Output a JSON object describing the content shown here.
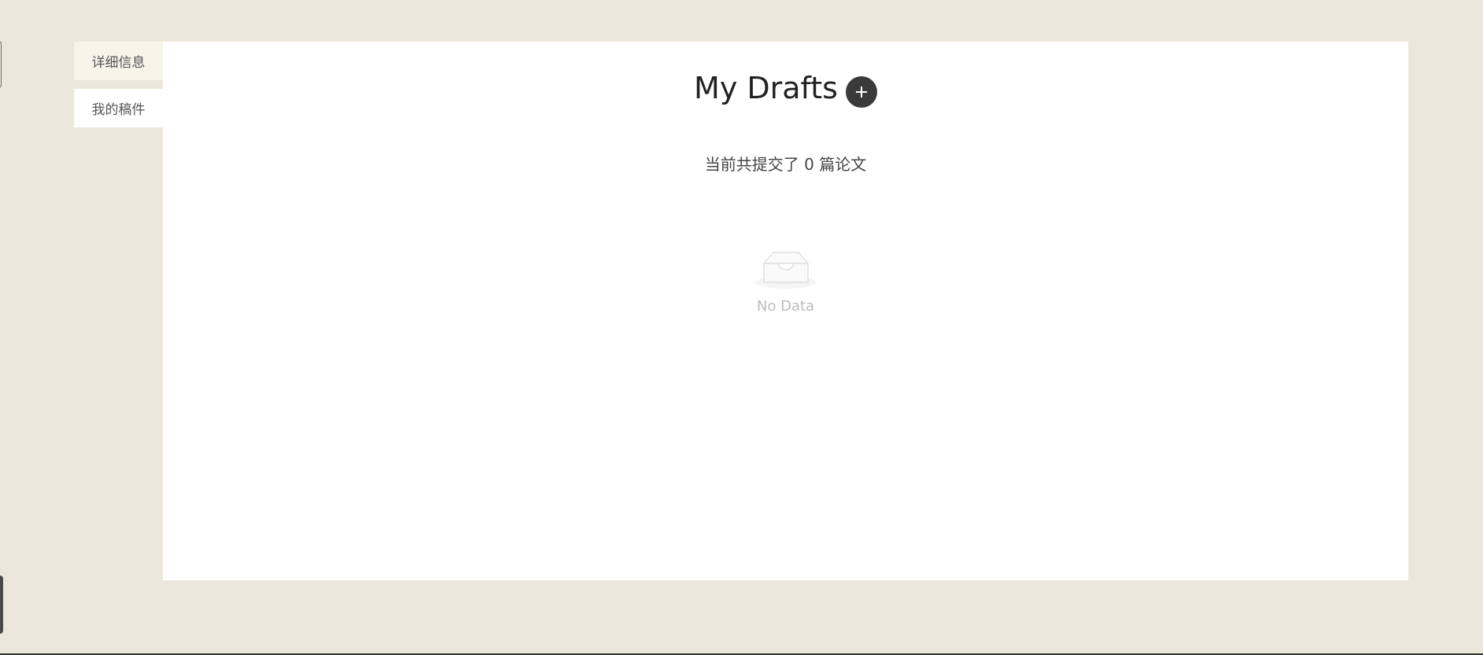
{
  "tabs": [
    {
      "label": "详细信息"
    },
    {
      "label": "我的稿件"
    }
  ],
  "main": {
    "title": "My Drafts",
    "summary": "当前共提交了 0 篇论文",
    "empty_text": "No Data"
  },
  "icons": {
    "add": "plus-icon",
    "empty": "empty-inbox-icon"
  },
  "colors": {
    "background": "#ebe7da",
    "panel": "#ffffff",
    "add_button": "#3a3a3a"
  }
}
